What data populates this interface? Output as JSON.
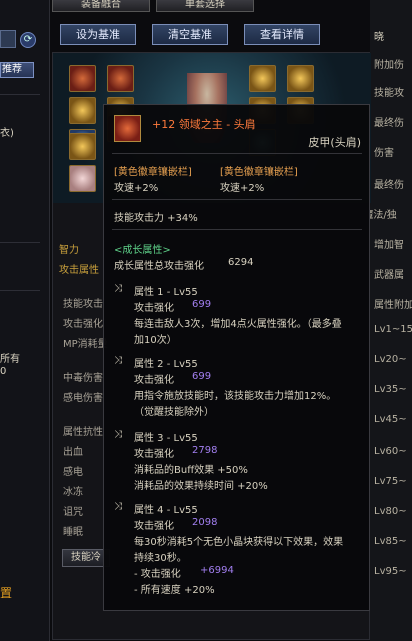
{
  "top_tabs": [
    "装备融合",
    "单套选择"
  ],
  "left": {
    "recommend_label": "推荐",
    "texts": [
      "衣)",
      "所有",
      "0",
      "置"
    ]
  },
  "right": {
    "texts": [
      "晓",
      "附加伤",
      "技能攻",
      "最终伤",
      "伤害",
      "最终伤",
      "物理/魔法/独",
      "增加智",
      "武器属",
      "属性附加",
      "Lv1~15",
      "Lv20~",
      "Lv35~",
      "Lv45~",
      "Lv60~",
      "Lv75~",
      "Lv80~",
      "Lv85~",
      "Lv95~"
    ]
  },
  "toolbar": {
    "set_base": "设为基准",
    "clear_base": "清空基准",
    "view_detail": "查看详情"
  },
  "under_panel": {
    "left_labels": [
      "智力",
      "攻击属性",
      "技能攻击",
      "攻击强化",
      "MP消耗量",
      "中毒伤害",
      "感电伤害",
      "属性抗性",
      "出血",
      "感电",
      "冰冻",
      "诅咒",
      "睡眠"
    ],
    "right_labels": [
      "物理攻击",
      "魔法攻击",
      "独立攻击",
      "攻击速度",
      "施放速度"
    ],
    "bottom_button": "技能冷"
  },
  "tooltip": {
    "title": "+12 领域之主 - 头肩",
    "type": "皮甲(头肩)",
    "slot_a_label": "[黄色徽章镶嵌栏]",
    "slot_a_value": "攻速+2%",
    "slot_b_label": "[黄色徽章镶嵌栏]",
    "slot_b_value": "攻速+2%",
    "skill_attack": "技能攻击力 +34%",
    "growth_header": "<成长属性>",
    "growth_total_label": "成长属性总攻击强化",
    "growth_total_value": "6294",
    "attr1_title": "属性 1 - Lv55",
    "attr1_label": "攻击强化",
    "attr1_value": "699",
    "attr1_desc1": "每连击敌人3次，增加4点火属性强化。（最多叠",
    "attr1_desc2": "加10次）",
    "attr2_title": "属性 2 - Lv55",
    "attr2_label": "攻击强化",
    "attr2_value": "699",
    "attr2_desc1": "用指令施放技能时，该技能攻击力增加12%。",
    "attr2_desc2": "（觉醒技能除外）",
    "attr3_title": "属性 3 - Lv55",
    "attr3_label": "攻击强化",
    "attr3_value": "2798",
    "attr3_desc1": "消耗品的Buff效果 +50%",
    "attr3_desc2": "消耗品的效果持续时间 +20%",
    "attr4_title": "属性 4 - Lv55",
    "attr4_label": "攻击强化",
    "attr4_value": "2098",
    "attr4_desc1": "每30秒消耗5个无色小晶块获得以下效果，效果",
    "attr4_desc2": "持续30秒。",
    "attr4_bonus1_label": "- 攻击强化",
    "attr4_bonus1_value": "+6994",
    "attr4_bonus2": "- 所有速度 +20%"
  },
  "colors": {
    "title_orange": "#ff7a3c",
    "green": "#5fd38a",
    "purple": "#a27ff0",
    "gold": "#c9a03c"
  }
}
